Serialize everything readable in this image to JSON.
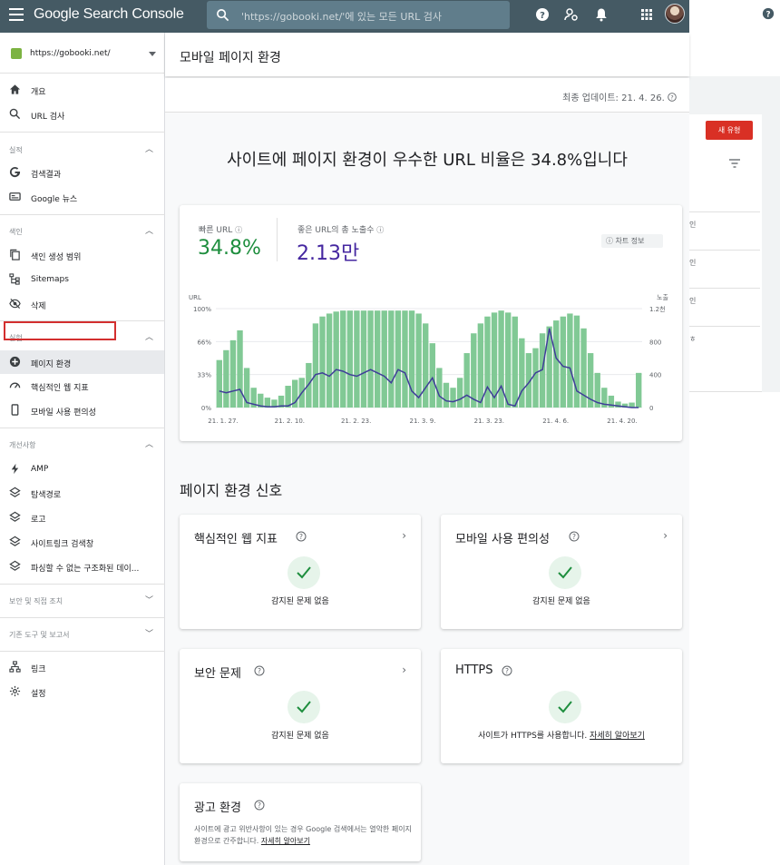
{
  "topbar": {
    "brand": "Google Search Console",
    "search_placeholder": "'https://gobooki.net/'에 있는 모든 URL 검사"
  },
  "sidebar": {
    "property": "https://gobooki.net/",
    "items": [
      {
        "label": "개요",
        "icon": "home-icon"
      },
      {
        "label": "URL 검사",
        "icon": "search-icon"
      }
    ],
    "performance": {
      "title": "실적",
      "items": [
        {
          "label": "검색결과",
          "icon": "google-g-icon"
        },
        {
          "label": "Google 뉴스",
          "icon": "news-icon"
        }
      ]
    },
    "index": {
      "title": "색인",
      "items": [
        {
          "label": "색인 생성 범위",
          "icon": "copy-icon"
        },
        {
          "label": "Sitemaps",
          "icon": "sitemap-icon"
        },
        {
          "label": "삭제",
          "icon": "eye-off-icon"
        }
      ]
    },
    "experience": {
      "title": "실험",
      "items": [
        {
          "label": "페이지 환경",
          "icon": "plus-circle-icon"
        },
        {
          "label": "핵심적인 웹 지표",
          "icon": "gauge-icon"
        },
        {
          "label": "모바일 사용 편의성",
          "icon": "phone-icon"
        }
      ]
    },
    "enhancements": {
      "title": "개선사항",
      "items": [
        {
          "label": "AMP",
          "icon": "bolt-icon"
        },
        {
          "label": "탐색경로",
          "icon": "layers-icon"
        },
        {
          "label": "로고",
          "icon": "layers-icon"
        },
        {
          "label": "사이트링크 검색창",
          "icon": "layers-icon"
        },
        {
          "label": "파싱할 수 없는 구조화된 데이...",
          "icon": "layers-icon"
        }
      ]
    },
    "security": {
      "title": "보안 및 직접 조치"
    },
    "legacy": {
      "title": "기존 도구 및 보고서"
    },
    "bottom": [
      {
        "label": "링크",
        "icon": "links-icon"
      },
      {
        "label": "설정",
        "icon": "gear-icon"
      }
    ]
  },
  "main": {
    "title": "모바일 페이지 환경",
    "updated": "최종 업데이트: 21. 4. 26.",
    "headline": "사이트에 페이지 환경이 우수한 URL 비율은 34.8%입니다",
    "metric1_label": "빠른 URL",
    "metric1_value": "34.8%",
    "metric2_label": "좋은 URL의 총 노출수",
    "metric2_value": "2.13만",
    "chart_info": "차트 정보",
    "signals_title": "페이지 환경 신호",
    "cards": [
      {
        "title": "핵심적인 웹 지표",
        "status": "감지된 문제 없음"
      },
      {
        "title": "모바일 사용 편의성",
        "status": "감지된 문제 없음"
      },
      {
        "title": "보안 문제",
        "status": "감지된 문제 없음"
      },
      {
        "title": "HTTPS",
        "status": "사이트가 HTTPS를 사용합니다.",
        "link": "자세히 알아보기"
      }
    ],
    "ads": {
      "title": "광고 환경",
      "text": "사이트에 광고 위반사항이 있는 경우 Google 검색에서는 열악한 페이지 환경으로 간주합니다.",
      "link": "자세히 알아보기"
    }
  },
  "backdrop": {
    "button": "새 유형",
    "frag": [
      "s",
      "인",
      "인",
      "인",
      "ㅎ"
    ]
  },
  "colors": {
    "topbar": "#455a64",
    "bar": "#81c995",
    "line": "#3f3d99",
    "good": "#1e8e3e",
    "impr": "#4527a0",
    "red": "#d32f2f"
  },
  "chart_data": {
    "type": "bar",
    "left_axis_label": "URL",
    "right_axis_label": "노출",
    "left_ticks": [
      "100%",
      "66%",
      "33%",
      "0%"
    ],
    "right_ticks": [
      "1.2천",
      "800",
      "400",
      "0"
    ],
    "x_ticks": [
      "21. 1. 27.",
      "21. 2. 10.",
      "21. 2. 23.",
      "21. 3. 9.",
      "21. 3. 23.",
      "21. 4. 6.",
      "21. 4. 20."
    ],
    "ylim": [
      0,
      100
    ],
    "y2lim": [
      0,
      1200
    ],
    "series": [
      {
        "name": "빠른 URL",
        "values": [
          48,
          58,
          68,
          78,
          40,
          20,
          14,
          10,
          8,
          12,
          22,
          28,
          30,
          45,
          85,
          92,
          95,
          97,
          98,
          98,
          98,
          98,
          98,
          98,
          98,
          98,
          98,
          98,
          98,
          95,
          85,
          65,
          40,
          25,
          20,
          30,
          55,
          75,
          85,
          92,
          96,
          98,
          96,
          92,
          70,
          55,
          60,
          75,
          82,
          88,
          92,
          95,
          93,
          80,
          55,
          35,
          20,
          12,
          6,
          4,
          5,
          35
        ]
      },
      {
        "name": "노출",
        "values": [
          200,
          180,
          200,
          220,
          60,
          40,
          20,
          10,
          10,
          20,
          20,
          60,
          180,
          280,
          400,
          420,
          380,
          460,
          440,
          400,
          380,
          420,
          460,
          420,
          380,
          300,
          460,
          420,
          200,
          120,
          240,
          360,
          140,
          80,
          70,
          100,
          150,
          100,
          60,
          250,
          120,
          260,
          40,
          20,
          200,
          300,
          420,
          460,
          960,
          600,
          500,
          480,
          200,
          150,
          100,
          60,
          40,
          30,
          20,
          10,
          0,
          0
        ]
      }
    ]
  }
}
